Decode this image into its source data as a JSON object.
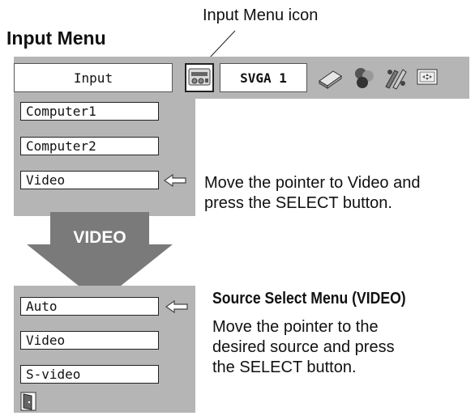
{
  "callout": {
    "label": "Input Menu icon"
  },
  "section_title": "Input Menu",
  "menubar": {
    "input_label": "Input",
    "signal_label": "SVGA 1",
    "icons": [
      "input-menu-icon",
      "pc-adjust-icon",
      "image-select-icon",
      "image-adjust-icon",
      "setting-icon",
      "screen-icon"
    ]
  },
  "input_menu": {
    "options": [
      "Computer1",
      "Computer2",
      "Video"
    ],
    "selected": "Video"
  },
  "note1": {
    "line1": "Move the pointer to Video and",
    "line2": "press the SELECT button."
  },
  "arrow": {
    "label": "VIDEO"
  },
  "source_menu": {
    "options": [
      "Auto",
      "Video",
      "S-video"
    ],
    "selected": "Auto",
    "exit_icon": "exit-door-icon"
  },
  "note2": {
    "title": "Source Select Menu (VIDEO)",
    "line1": "Move the pointer to the",
    "line2": "desired source and press",
    "line3": "the SELECT button."
  },
  "colors": {
    "panel": "#b5b5b5",
    "arrow": "#7a7a7a"
  }
}
